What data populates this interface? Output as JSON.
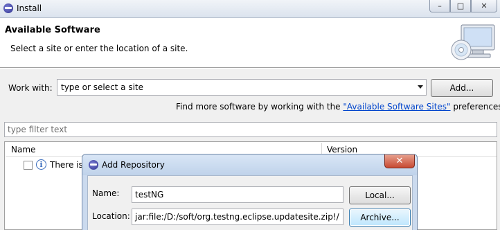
{
  "window": {
    "title": "Install",
    "minimize_glyph": "–",
    "maximize_glyph": "□",
    "close_glyph": "✕"
  },
  "header": {
    "title": "Available Software",
    "subtitle": "Select a site or enter the location of a site.",
    "icon": "monitor-cd-icon"
  },
  "work_with": {
    "label": "Work with:",
    "value": "type or select a site",
    "add_button": "Add..."
  },
  "find_more": {
    "prefix": "Find more software by working with the ",
    "link": "\"Available Software Sites\"",
    "suffix": " preferences."
  },
  "filter": {
    "placeholder": "type filter text"
  },
  "tree": {
    "columns": [
      "Name",
      "Version"
    ],
    "rows": [
      {
        "text": "There is"
      }
    ]
  },
  "dialog": {
    "title": "Add Repository",
    "close_glyph": "✕",
    "name_label": "Name:",
    "name_value": "testNG",
    "local_button": "Local...",
    "location_label": "Location:",
    "location_value": "jar:file:/D:/soft/org.testng.eclipse.updatesite.zip!/",
    "archive_button": "Archive..."
  },
  "colors": {
    "link": "#0044cc",
    "dialog_frame": "#cbdaee",
    "close_button": "#c74a33"
  }
}
